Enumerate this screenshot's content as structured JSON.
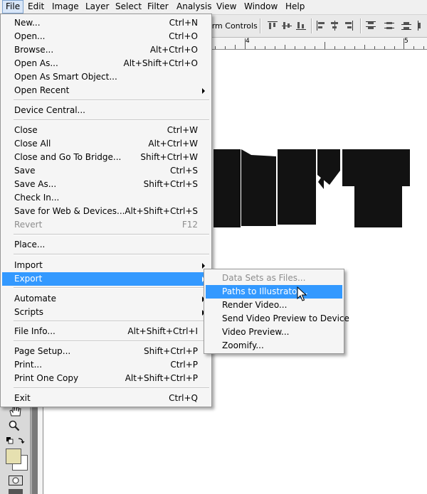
{
  "menubar": {
    "items": [
      "File",
      "Edit",
      "Image",
      "Layer",
      "Select",
      "Filter",
      "Analysis",
      "View",
      "Window",
      "Help"
    ]
  },
  "options_bar": {
    "transform_controls_label": "orm Controls"
  },
  "ruler": {
    "number": "4",
    "number2": "5"
  },
  "file_menu": {
    "items": [
      {
        "label": "New...",
        "shortcut": "Ctrl+N"
      },
      {
        "label": "Open...",
        "shortcut": "Ctrl+O"
      },
      {
        "label": "Browse...",
        "shortcut": "Alt+Ctrl+O"
      },
      {
        "label": "Open As...",
        "shortcut": "Alt+Shift+Ctrl+O"
      },
      {
        "label": "Open As Smart Object...",
        "shortcut": ""
      },
      {
        "label": "Open Recent",
        "shortcut": ""
      },
      {
        "label": "Device Central...",
        "shortcut": ""
      },
      {
        "label": "Close",
        "shortcut": "Ctrl+W"
      },
      {
        "label": "Close All",
        "shortcut": "Alt+Ctrl+W"
      },
      {
        "label": "Close and Go To Bridge...",
        "shortcut": "Shift+Ctrl+W"
      },
      {
        "label": "Save",
        "shortcut": "Ctrl+S"
      },
      {
        "label": "Save As...",
        "shortcut": "Shift+Ctrl+S"
      },
      {
        "label": "Check In...",
        "shortcut": ""
      },
      {
        "label": "Save for Web & Devices...",
        "shortcut": "Alt+Shift+Ctrl+S"
      },
      {
        "label": "Revert",
        "shortcut": "F12"
      },
      {
        "label": "Place...",
        "shortcut": ""
      },
      {
        "label": "Import",
        "shortcut": ""
      },
      {
        "label": "Export",
        "shortcut": ""
      },
      {
        "label": "Automate",
        "shortcut": ""
      },
      {
        "label": "Scripts",
        "shortcut": ""
      },
      {
        "label": "File Info...",
        "shortcut": "Alt+Shift+Ctrl+I"
      },
      {
        "label": "Page Setup...",
        "shortcut": "Shift+Ctrl+P"
      },
      {
        "label": "Print...",
        "shortcut": "Ctrl+P"
      },
      {
        "label": "Print One Copy",
        "shortcut": "Alt+Shift+Ctrl+P"
      },
      {
        "label": "Exit",
        "shortcut": "Ctrl+Q"
      }
    ]
  },
  "export_menu": {
    "items": [
      {
        "label": "Data Sets as Files..."
      },
      {
        "label": "Paths to Illustrator..."
      },
      {
        "label": "Render Video..."
      },
      {
        "label": "Send Video Preview to Device"
      },
      {
        "label": "Video Preview..."
      },
      {
        "label": "Zoomify..."
      }
    ]
  },
  "colors": {
    "highlight": "#3399ff",
    "foreground_swatch": "#e6e0b0",
    "background_swatch": "#ffffff"
  }
}
